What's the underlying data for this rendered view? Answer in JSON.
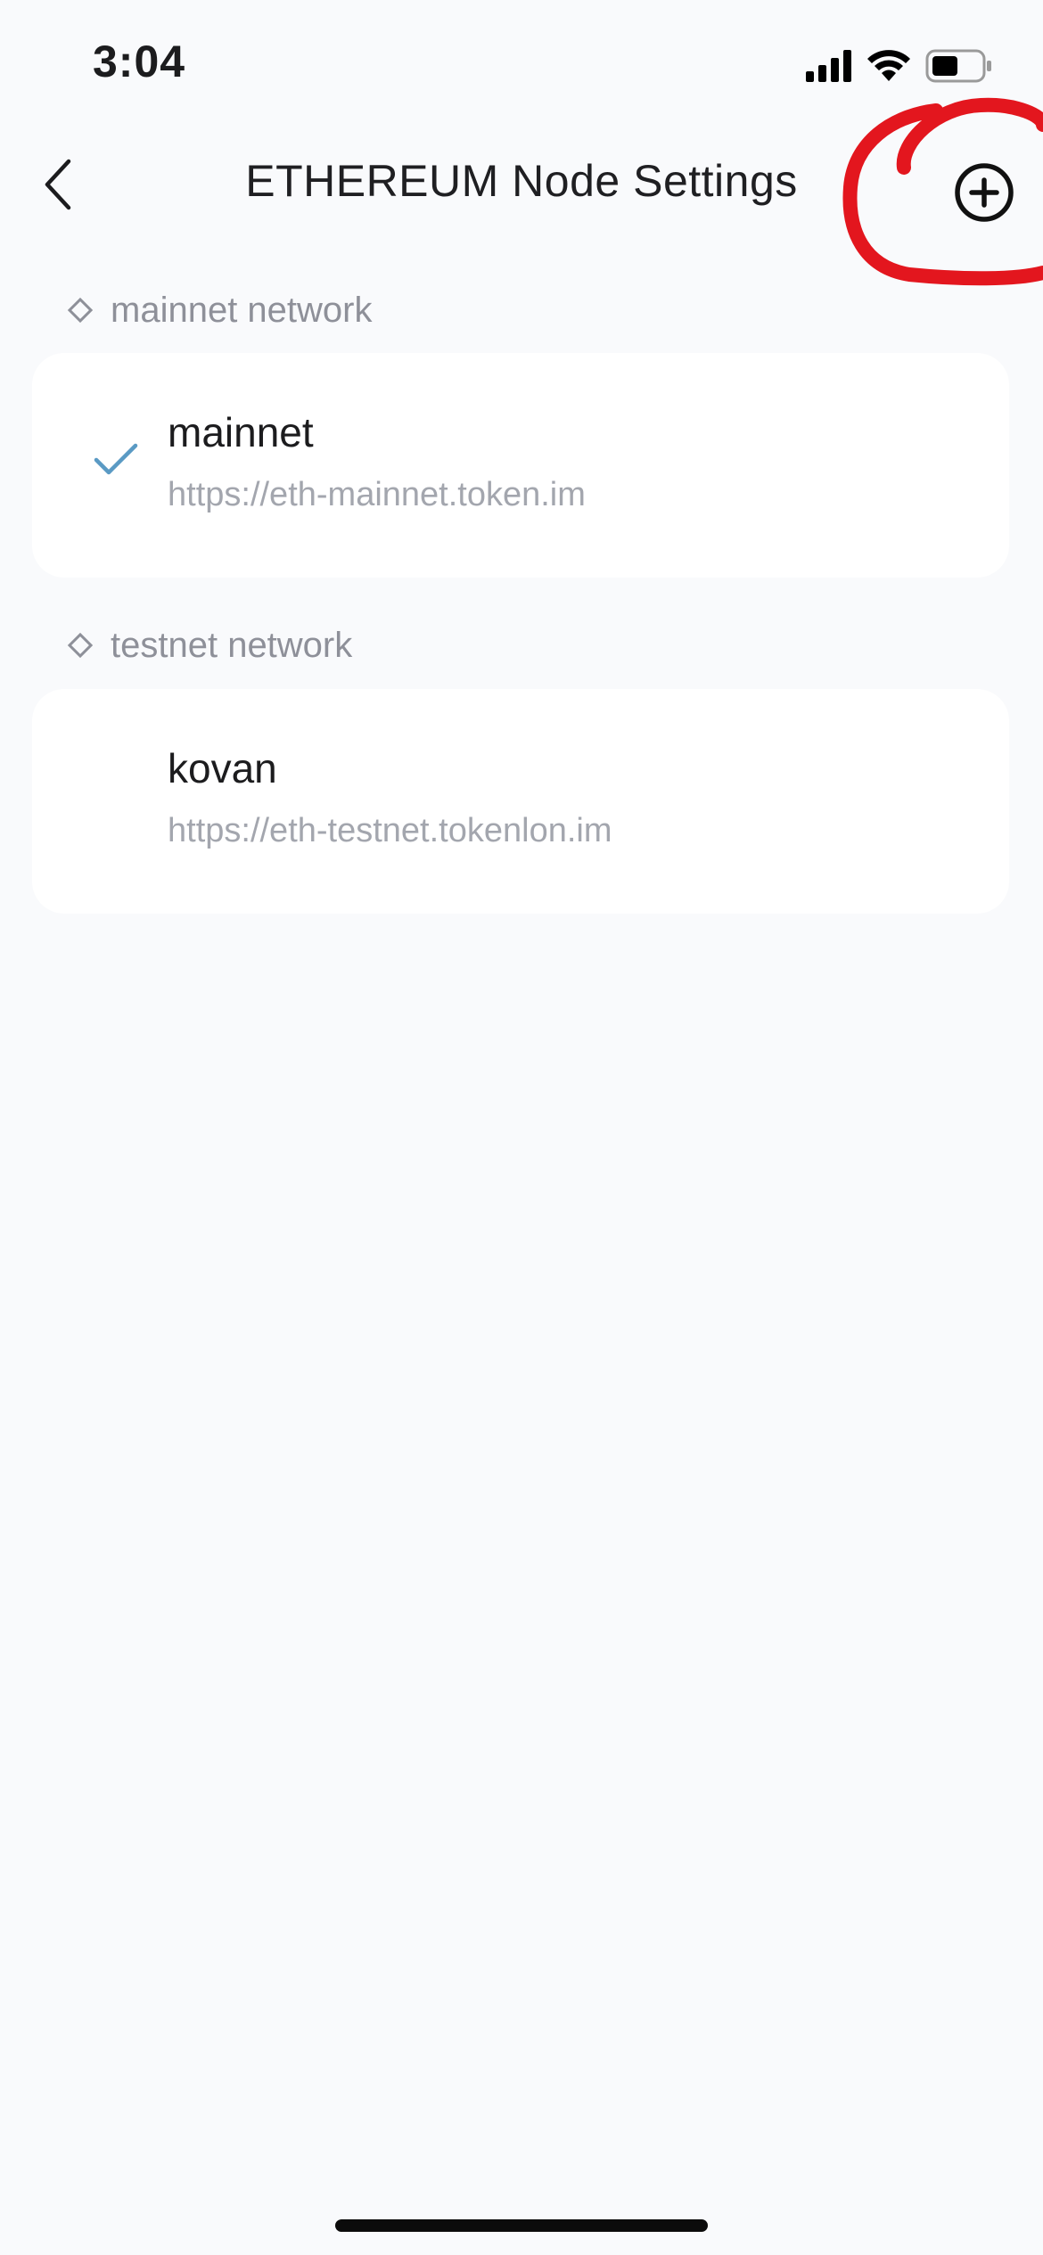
{
  "status_bar": {
    "time": "3:04"
  },
  "header": {
    "title": "ETHEREUM Node Settings",
    "back_icon": "chevron-left-icon",
    "add_icon": "plus-circle-icon"
  },
  "sections": [
    {
      "label": "mainnet network",
      "nodes": [
        {
          "name": "mainnet",
          "url": "https://eth-mainnet.token.im",
          "selected": true
        }
      ]
    },
    {
      "label": "testnet network",
      "nodes": [
        {
          "name": "kovan",
          "url": "https://eth-testnet.tokenlon.im",
          "selected": false
        }
      ]
    }
  ],
  "colors": {
    "background": "#f9fafc",
    "card": "#ffffff",
    "check": "#5a9ac4",
    "annotation": "#e3161e",
    "secondary_text": "#a3a6ae"
  }
}
